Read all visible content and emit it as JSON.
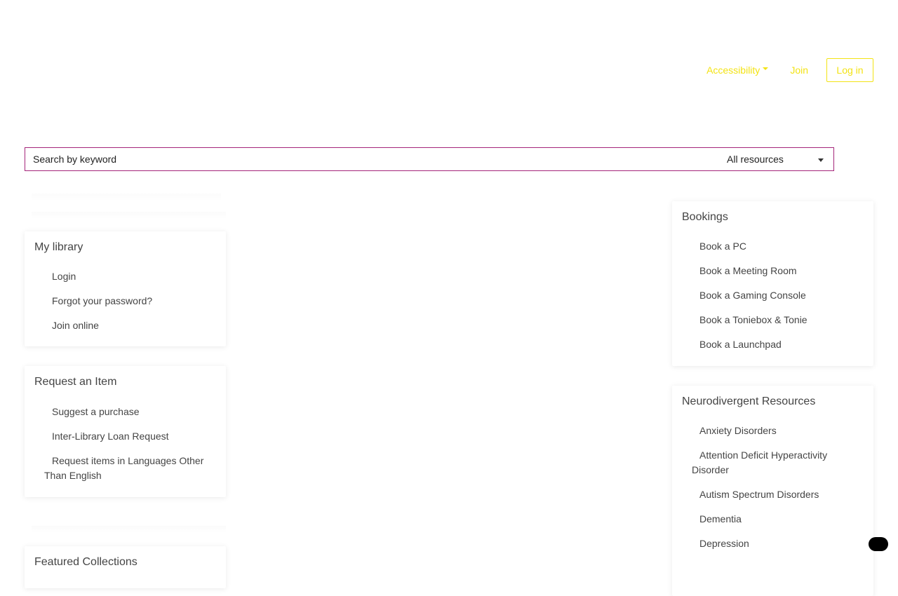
{
  "header": {
    "accessibility_label": "Accessibility",
    "join_label": "Join",
    "login_label": "Log in",
    "accent_color": "#f3e314"
  },
  "search": {
    "placeholder": "Search by keyword",
    "scope_selected": "All resources",
    "border_color": "#a4257a"
  },
  "my_library": {
    "title": "My library",
    "items": [
      "Login",
      "Forgot your password?",
      "Join online"
    ]
  },
  "request_item": {
    "title": "Request an Item",
    "items": [
      "Suggest a purchase",
      "Inter-Library Loan Request",
      "Request items in Languages Other Than English"
    ]
  },
  "featured": {
    "title": "Featured Collections"
  },
  "bookings": {
    "title": "Bookings",
    "items": [
      "Book a PC",
      "Book a Meeting Room",
      "Book a Gaming Console",
      "Book a Toniebox & Tonie",
      "Book a Launchpad"
    ]
  },
  "neurodivergent": {
    "title": "Neurodivergent Resources",
    "items": [
      "Anxiety Disorders",
      "Attention Deficit Hyperactivity Disorder",
      "Autism Spectrum Disorders",
      "Dementia",
      "Depression"
    ]
  },
  "chat": {
    "icon": "chat-bubble-icon"
  }
}
